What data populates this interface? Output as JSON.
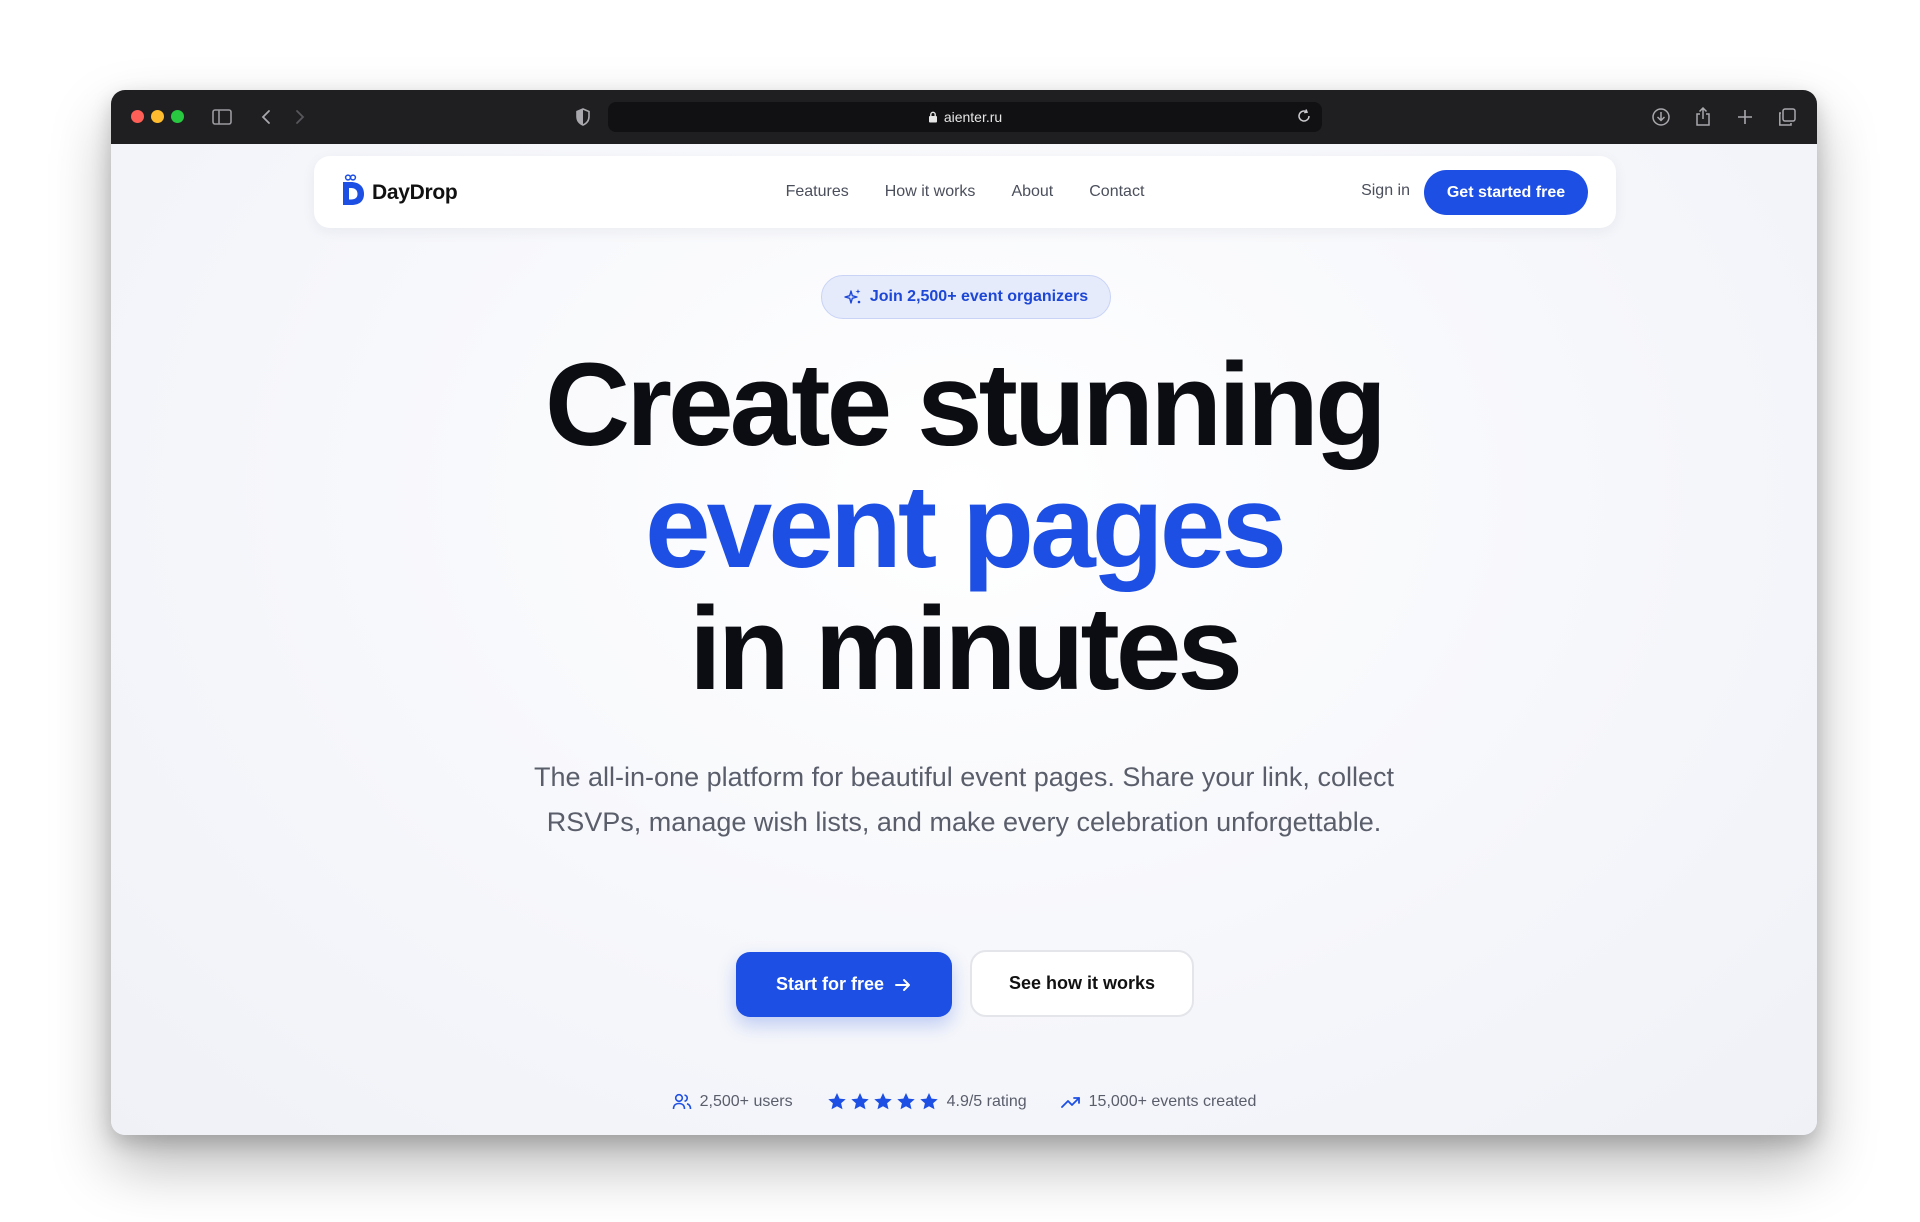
{
  "browser": {
    "url": "aienter.ru"
  },
  "nav": {
    "logo_text": "DayDrop",
    "links": [
      "Features",
      "How it works",
      "About",
      "Contact"
    ],
    "signin_label": "Sign in",
    "cta_label": "Get started free"
  },
  "hero": {
    "badge": "Join 2,500+ event organizers",
    "title_line1": "Create stunning",
    "title_line2": "event pages",
    "title_line3": "in minutes",
    "subtitle": "The all-in-one platform for beautiful event pages. Share your link, collect RSVPs, manage wish lists, and make every celebration unforgettable.",
    "primary_button": "Start for free",
    "secondary_button": "See how it works"
  },
  "stats": {
    "users": "2,500+ users",
    "rating": "4.9/5 rating",
    "rating_value": 4.9,
    "stars": 5,
    "events": "15,000+ events created"
  },
  "colors": {
    "accent": "#1d4fe4",
    "chrome": "#1f1f21",
    "text_dark": "#0c0d12",
    "text_muted": "#5a5e6b"
  }
}
